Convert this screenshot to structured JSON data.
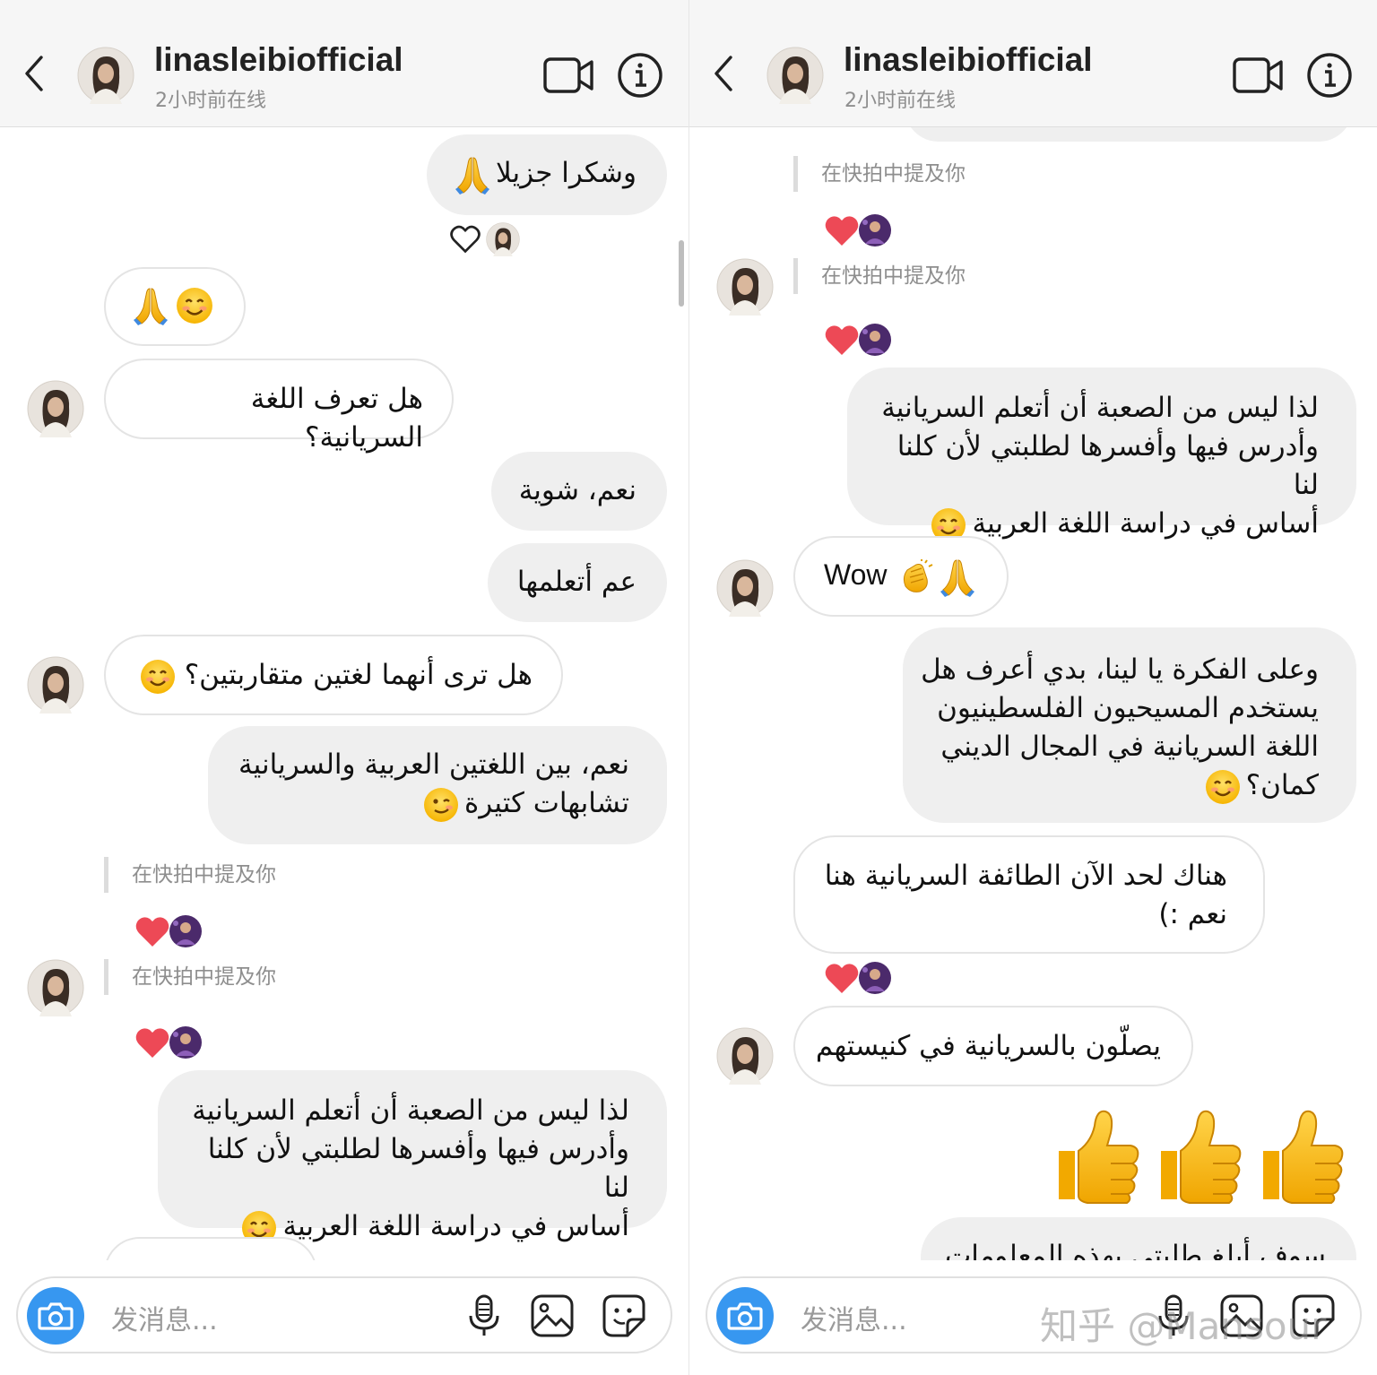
{
  "theme": {
    "accent": "#3797f0",
    "heart": "#ed4956",
    "bubble_out": "#efefef",
    "muted": "#8e8e8e"
  },
  "header": {
    "username": "linasleibiofficial",
    "status": "2小时前在线",
    "icons": [
      "back-arrow-icon",
      "video-camera-icon",
      "info-icon"
    ]
  },
  "composer": {
    "placeholder": "发消息...",
    "icons": [
      "camera-icon",
      "microphone-icon",
      "gallery-icon",
      "sticker-icon"
    ]
  },
  "mention_text": "在快拍中提及你",
  "left_messages": [
    {
      "dir": "out",
      "text": "وشكرا جزيلا",
      "emoji": [
        "pray"
      ]
    },
    {
      "dir": "in",
      "text": "",
      "emoji": [
        "smile",
        "pray"
      ]
    },
    {
      "dir": "in",
      "text": "هل تعرف اللغة السريانية؟",
      "emoji": []
    },
    {
      "dir": "out",
      "text": "نعم، شوية",
      "emoji": []
    },
    {
      "dir": "out",
      "text": "عم أتعلمها",
      "emoji": []
    },
    {
      "dir": "in",
      "text": "هل ترى أنهما لغتين متقاربتين؟",
      "emoji": [
        "smile"
      ]
    },
    {
      "dir": "out",
      "lines": [
        "نعم، بين اللغتين العربية والسريانية",
        "تشابهات كتيرة"
      ],
      "emoji": [
        "wink"
      ]
    },
    {
      "dir": "out",
      "lines": [
        "لذا ليس من الصعبة أن أتعلم السريانية",
        "وأدرس فيها وأفسرها لطلبتي لأن كلنا لنا",
        "أساس في دراسة اللغة العربية"
      ],
      "emoji": [
        "smile"
      ]
    }
  ],
  "right_messages": [
    {
      "dir": "out",
      "lines": [
        "لذا ليس من الصعبة أن أتعلم السريانية",
        "وأدرس فيها وأفسرها لطلبتي لأن كلنا لنا",
        "أساس في دراسة اللغة العربية"
      ],
      "emoji": [
        "smile"
      ]
    },
    {
      "dir": "in",
      "text": "Wow",
      "emoji": [
        "clap",
        "pray"
      ]
    },
    {
      "dir": "out",
      "lines": [
        "وعلى الفكرة يا لينا، بدي أعرف هل",
        "يستخدم المسيحيون الفلسطينيون",
        "اللغة السريانية في المجال الديني",
        "كمان؟"
      ],
      "emoji": [
        "smile"
      ]
    },
    {
      "dir": "in",
      "lines": [
        "هناك لحد الآن الطائفة السريانية هنا",
        "نعم :)"
      ],
      "emoji": []
    },
    {
      "dir": "in",
      "text": "يصلّون بالسريانية في كنيستهم",
      "emoji": []
    },
    {
      "dir": "out",
      "text": "",
      "emoji": [
        "thumbs-up",
        "thumbs-up",
        "thumbs-up"
      ]
    },
    {
      "dir": "out",
      "text": "سوف أبلغ طلبتي بهذه المعلومات",
      "emoji": []
    }
  ],
  "watermark": "知乎 @Mansour"
}
